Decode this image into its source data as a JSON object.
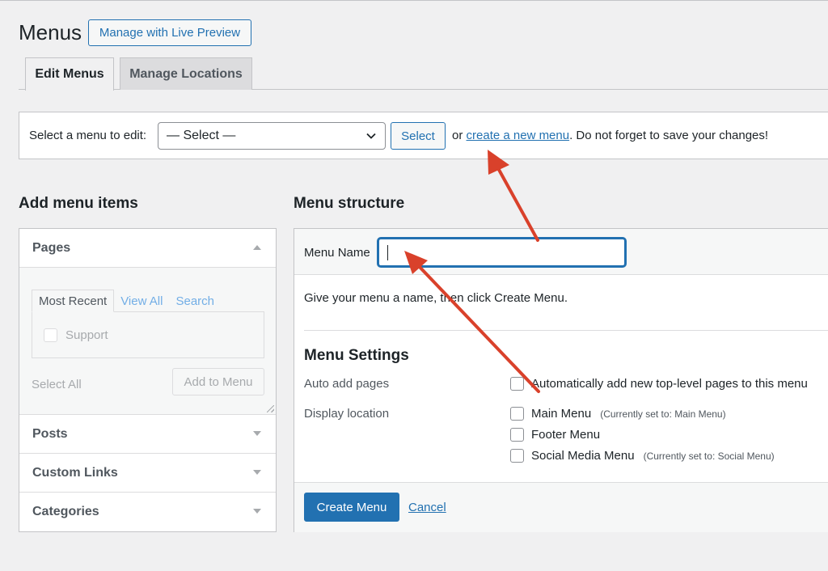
{
  "header": {
    "title": "Menus",
    "live_preview_label": "Manage with Live Preview"
  },
  "tabs": [
    {
      "label": "Edit Menus",
      "active": true
    },
    {
      "label": "Manage Locations",
      "active": false
    }
  ],
  "select_bar": {
    "label": "Select a menu to edit:",
    "selected_value": "— Select —",
    "select_button": "Select",
    "note_prefix": "or",
    "create_link": "create a new menu",
    "note_suffix": ". Do not forget to save your changes!"
  },
  "add_items": {
    "heading": "Add menu items",
    "sections": [
      {
        "label": "Pages",
        "expanded": true
      },
      {
        "label": "Posts",
        "expanded": false
      },
      {
        "label": "Custom Links",
        "expanded": false
      },
      {
        "label": "Categories",
        "expanded": false
      }
    ],
    "pages": {
      "subtabs": [
        "Most Recent",
        "View All",
        "Search"
      ],
      "items": [
        "Support"
      ],
      "select_all": "Select All",
      "add_button": "Add to Menu"
    }
  },
  "menu_structure": {
    "heading": "Menu structure",
    "name_label": "Menu Name",
    "name_value": "",
    "instruction": "Give your menu a name, then click Create Menu.",
    "settings_heading": "Menu Settings",
    "auto_add_label": "Auto add pages",
    "auto_add_option": "Automatically add new top-level pages to this menu",
    "display_label": "Display location",
    "locations": [
      {
        "label": "Main Menu",
        "note": "(Currently set to: Main Menu)"
      },
      {
        "label": "Footer Menu",
        "note": ""
      },
      {
        "label": "Social Media Menu",
        "note": "(Currently set to: Social Menu)"
      }
    ],
    "create_button": "Create Menu",
    "cancel_link": "Cancel"
  },
  "colors": {
    "accent": "#2271b1",
    "annotation_arrow": "#d9412b"
  },
  "icons": [
    "chevron-down-icon",
    "arrow-up-icon",
    "arrow-down-icon"
  ]
}
